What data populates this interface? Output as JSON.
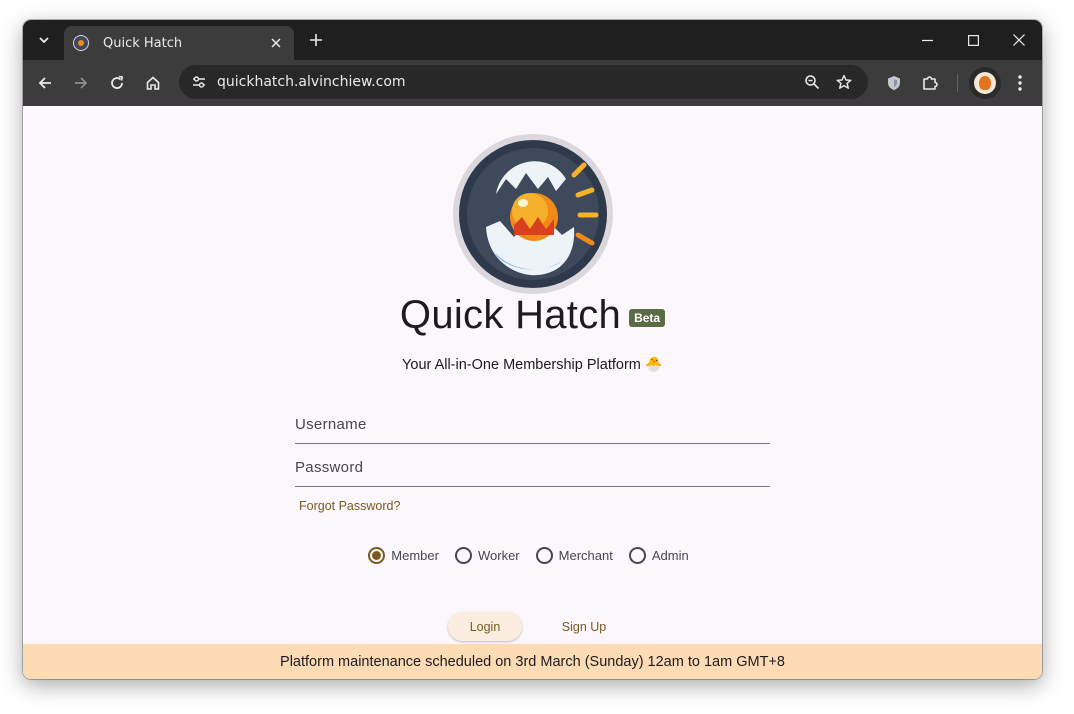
{
  "browser": {
    "tab_title": "Quick Hatch",
    "url": "quickhatch.alvinchiew.com"
  },
  "app": {
    "title": "Quick Hatch",
    "badge": "Beta",
    "tagline": "Your All-in-One Membership Platform 🐣"
  },
  "form": {
    "username_placeholder": "Username",
    "password_placeholder": "Password",
    "forgot_password": "Forgot Password?",
    "roles": [
      "Member",
      "Worker",
      "Merchant",
      "Admin"
    ],
    "selected_role": "Member",
    "login_label": "Login",
    "signup_label": "Sign Up"
  },
  "banner": {
    "text": "Platform maintenance scheduled on 3rd March (Sunday) 12am to 1am GMT+8"
  },
  "colors": {
    "accent": "#7a5a1e",
    "banner_bg": "#fddcb5",
    "beta_badge": "#5a6b45",
    "page_bg": "#fcf7fd"
  }
}
